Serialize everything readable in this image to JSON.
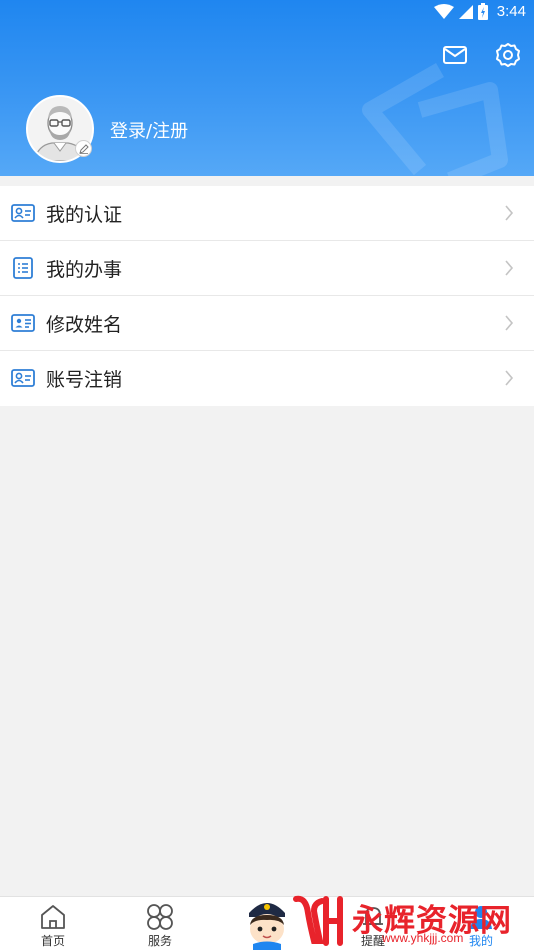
{
  "status_bar": {
    "time": "3:44"
  },
  "header": {
    "login_text": "登录/注册"
  },
  "menu": {
    "items": [
      {
        "label": "我的认证",
        "icon": "id-card-icon"
      },
      {
        "label": "我的办事",
        "icon": "task-list-icon"
      },
      {
        "label": "修改姓名",
        "icon": "name-card-icon"
      },
      {
        "label": "账号注销",
        "icon": "account-card-icon"
      }
    ]
  },
  "tabbar": {
    "tabs": [
      {
        "label": "首页",
        "icon": "home-icon",
        "active": false
      },
      {
        "label": "服务",
        "icon": "grid-icon",
        "active": false
      },
      {
        "label": "提醒",
        "icon": "bell-icon",
        "active": false
      },
      {
        "label": "我的",
        "icon": "user-icon",
        "active": true
      }
    ]
  },
  "watermark": {
    "brand": "永辉资源网",
    "url": "www.yhkjjj.com"
  },
  "colors": {
    "primary": "#1f86f0",
    "icon_blue": "#2f7fd6",
    "watermark_red": "#e8232b"
  }
}
